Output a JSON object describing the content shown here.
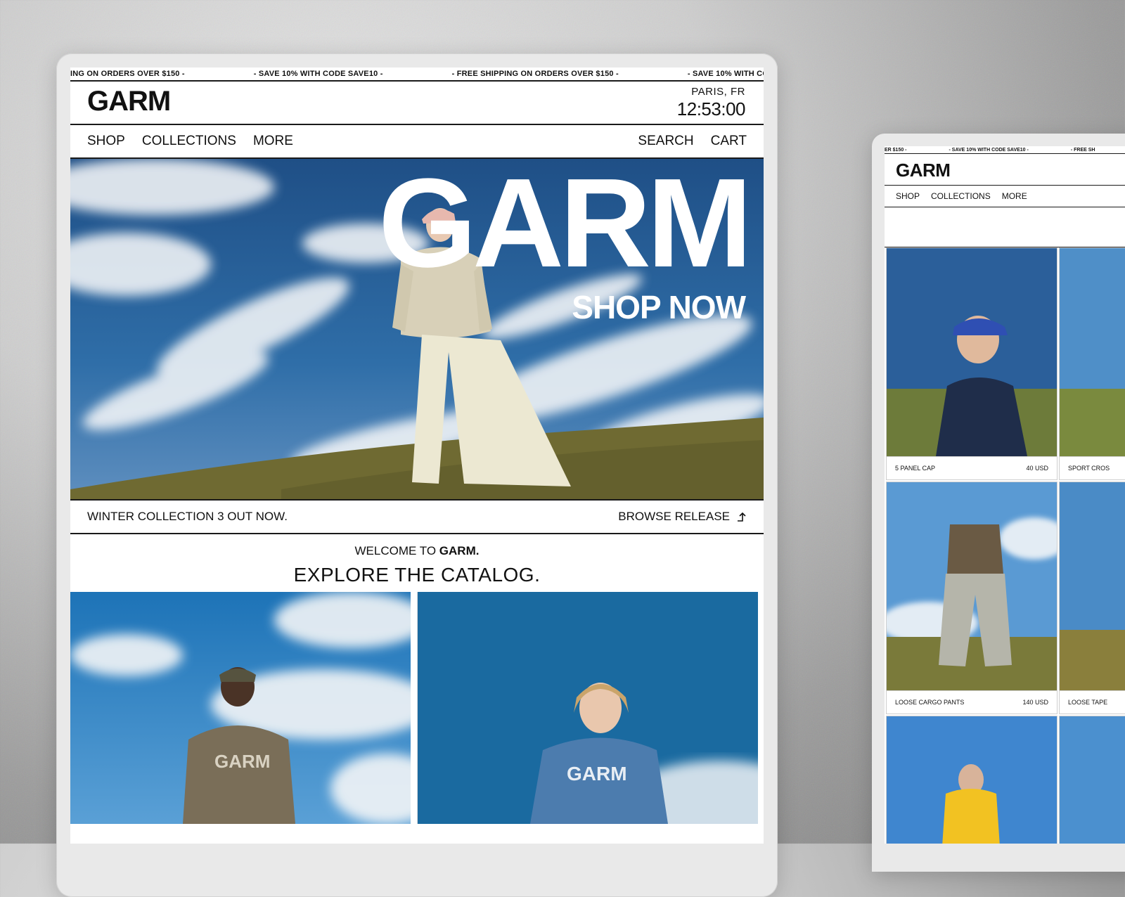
{
  "main": {
    "ticker": [
      "ING ON ORDERS OVER $150 -",
      "- SAVE 10% WITH CODE SAVE10 -",
      "- FREE SHIPPING ON ORDERS OVER $150 -",
      "- SAVE 10% WITH CODE"
    ],
    "brand": "GARM",
    "location": {
      "city": "PARIS, FR",
      "time": "12:53:00"
    },
    "nav_left": [
      "SHOP",
      "COLLECTIONS",
      "MORE"
    ],
    "nav_right": [
      "SEARCH",
      "CART"
    ],
    "hero": {
      "title": "GARM",
      "cta": "SHOP NOW"
    },
    "announcement": {
      "text": "WINTER COLLECTION 3 OUT NOW.",
      "link": "BROWSE RELEASE"
    },
    "welcome": {
      "prefix": "WELCOME TO ",
      "brand": "GARM.",
      "heading": "EXPLORE THE CATALOG."
    }
  },
  "side": {
    "ticker": [
      "ER $150 -",
      "- SAVE 10% WITH CODE SAVE10 -",
      "- FREE SH"
    ],
    "brand": "GARM",
    "nav": [
      "SHOP",
      "COLLECTIONS",
      "MORE"
    ],
    "products": [
      {
        "name": "5 PANEL CAP",
        "price": "40 USD"
      },
      {
        "name": "SPORT CROS",
        "price": ""
      },
      {
        "name": "LOOSE CARGO PANTS",
        "price": "140 USD"
      },
      {
        "name": "LOOSE TAPE",
        "price": ""
      }
    ]
  },
  "colors": {
    "sky": "#2e6aa8",
    "grass": "#6f6a32",
    "accent": "#111111"
  }
}
